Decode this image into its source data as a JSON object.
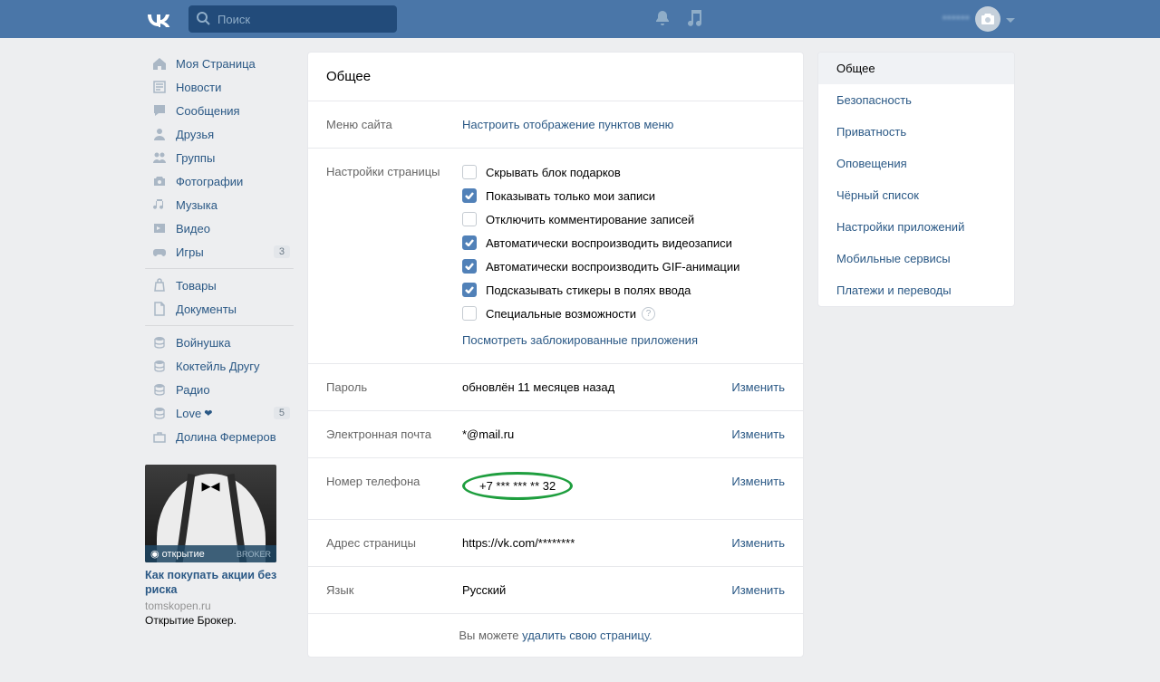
{
  "header": {
    "search_placeholder": "Поиск",
    "username": "******"
  },
  "leftnav": {
    "items": [
      {
        "key": "my-page",
        "label": "Моя Страница",
        "icon": "home"
      },
      {
        "key": "news",
        "label": "Новости",
        "icon": "news"
      },
      {
        "key": "messages",
        "label": "Сообщения",
        "icon": "chat"
      },
      {
        "key": "friends",
        "label": "Друзья",
        "icon": "user"
      },
      {
        "key": "groups",
        "label": "Группы",
        "icon": "users"
      },
      {
        "key": "photos",
        "label": "Фотографии",
        "icon": "camera"
      },
      {
        "key": "music",
        "label": "Музыка",
        "icon": "music"
      },
      {
        "key": "videos",
        "label": "Видео",
        "icon": "video"
      },
      {
        "key": "games",
        "label": "Игры",
        "icon": "game",
        "badge": "3"
      },
      {
        "sep": true
      },
      {
        "key": "market",
        "label": "Товары",
        "icon": "bag"
      },
      {
        "key": "docs",
        "label": "Документы",
        "icon": "doc"
      },
      {
        "sep": true
      },
      {
        "key": "app1",
        "label": "Войнушка",
        "icon": "stack"
      },
      {
        "key": "app2",
        "label": "Коктейль Другу",
        "icon": "stack"
      },
      {
        "key": "app3",
        "label": "Радио",
        "icon": "stack"
      },
      {
        "key": "app4",
        "label": "Love",
        "icon": "stack",
        "heart": true,
        "badge": "5"
      },
      {
        "key": "app5",
        "label": "Долина Фермеров",
        "icon": "case"
      }
    ]
  },
  "ad": {
    "brand": "открытие",
    "brand_sub": "BROKER",
    "title": "Как покупать акции без риска",
    "site": "tomskopen.ru",
    "desc": "Открытие Брокер."
  },
  "settings": {
    "title": "Общее",
    "sitemenu": {
      "label": "Меню сайта",
      "link": "Настроить отображение пунктов меню"
    },
    "pageopts": {
      "label": "Настройки страницы",
      "options": [
        {
          "label": "Скрывать блок подарков",
          "checked": false
        },
        {
          "label": "Показывать только мои записи",
          "checked": true
        },
        {
          "label": "Отключить комментирование записей",
          "checked": false
        },
        {
          "label": "Автоматически воспроизводить видеозаписи",
          "checked": true
        },
        {
          "label": "Автоматически воспроизводить GIF-анимации",
          "checked": true
        },
        {
          "label": "Подсказывать стикеры в полях ввода",
          "checked": true
        },
        {
          "label": "Специальные возможности",
          "checked": false,
          "help": true
        }
      ],
      "blocked_link": "Посмотреть заблокированные приложения"
    },
    "password": {
      "label": "Пароль",
      "value": "обновлён 11 месяцев назад",
      "edit": "Изменить"
    },
    "email": {
      "label": "Электронная почта",
      "value": "*@mail.ru",
      "edit": "Изменить"
    },
    "phone": {
      "label": "Номер телефона",
      "value": "+7 *** *** ** 32",
      "edit": "Изменить"
    },
    "address": {
      "label": "Адрес страницы",
      "value": "https://vk.com/********",
      "edit": "Изменить"
    },
    "lang": {
      "label": "Язык",
      "value": "Русский",
      "edit": "Изменить"
    },
    "footer": {
      "prefix": "Вы можете ",
      "link": "удалить свою страницу."
    }
  },
  "rightnav": {
    "items": [
      {
        "label": "Общее",
        "active": true
      },
      {
        "label": "Безопасность"
      },
      {
        "label": "Приватность"
      },
      {
        "label": "Оповещения"
      },
      {
        "label": "Чёрный список"
      },
      {
        "label": "Настройки приложений"
      },
      {
        "label": "Мобильные сервисы"
      },
      {
        "label": "Платежи и переводы"
      }
    ]
  }
}
